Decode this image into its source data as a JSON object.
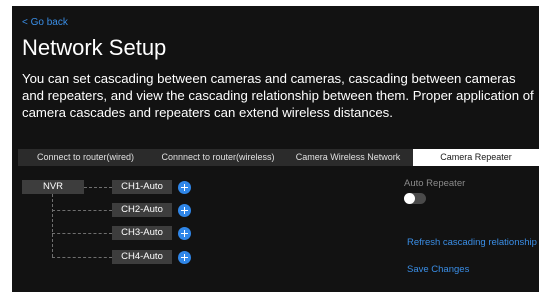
{
  "nav": {
    "back_label": "< Go back"
  },
  "page": {
    "title": "Network Setup",
    "description": "You can set cascading between cameras and cameras, cascading between cameras and repeaters, and view the cascading relationship between them. Proper application of camera cascades and repeaters can extend wireless distances."
  },
  "tabs": [
    {
      "label": "Connect to router(wired)",
      "active": false
    },
    {
      "label": "Connnect to router(wireless)",
      "active": false
    },
    {
      "label": "Camera Wireless Network",
      "active": false
    },
    {
      "label": "Camera Repeater",
      "active": true
    }
  ],
  "topology": {
    "root": "NVR",
    "channels": [
      "CH1-Auto",
      "CH2-Auto",
      "CH3-Auto",
      "CH4-Auto"
    ],
    "add_icon": "plus-circle-icon"
  },
  "settings": {
    "auto_repeater_label": "Auto Repeater",
    "auto_repeater_on": false,
    "refresh_label": "Refresh cascading relationship",
    "save_label": "Save Changes"
  },
  "colors": {
    "background": "#121212",
    "accent": "#2f86e8",
    "link": "#3a8ee6",
    "node": "#3d3d3d",
    "tab_bar": "#2b2b2b",
    "tab_active": "#ffffff"
  }
}
